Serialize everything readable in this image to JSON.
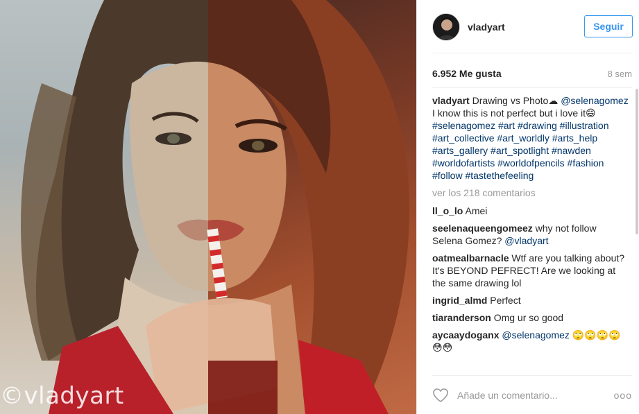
{
  "photo": {
    "watermark": "©vladyart",
    "alt": "Drawing vs Photo"
  },
  "header": {
    "username": "vladyart",
    "follow_label": "Seguir"
  },
  "stats": {
    "likes": "6.952 Me gusta",
    "time": "8 sem"
  },
  "caption": {
    "user": "vladyart",
    "text_1": "Drawing vs Photo☁",
    "mention": "@selenagomez",
    "text_2": "I know this is not perfect but i love it😄",
    "hashtags": "#selenagomez #art #drawing #illustration #art_collective #art_worldly #arts_help #arts_gallery #art_spotlight #nawden #worldofartists #worldofpencils #fashion #follow #tastethefeeling"
  },
  "more_comments": "ver los 218 comentarios",
  "comments": [
    {
      "user": "ll_o_lo",
      "text": "Amei",
      "mention": ""
    },
    {
      "user": "seelenaqueengomeez",
      "text": "why not follow Selena Gomez?",
      "mention": "@vladyart"
    },
    {
      "user": "oatmealbarnacle",
      "text": "Wtf are you talking about? It's BEYOND PEFRECT! Are we looking at the same drawing lol",
      "mention": ""
    },
    {
      "user": "ingrid_almd",
      "text": "Perfect",
      "mention": ""
    },
    {
      "user": "tiaranderson",
      "text": "Omg ur so good",
      "mention": ""
    },
    {
      "user": "aycaaydoganx",
      "text": "🙄🙄🙄🙄 😳😳",
      "mention": "@selenagomez"
    }
  ],
  "footer": {
    "add_comment_placeholder": "Añade un comentario...",
    "options_label": "ooo"
  },
  "colors": {
    "accent": "#3897f0",
    "hashtag": "#003569",
    "muted": "#999999"
  },
  "icons": [
    "heart-icon",
    "options-icon",
    "avatar"
  ]
}
